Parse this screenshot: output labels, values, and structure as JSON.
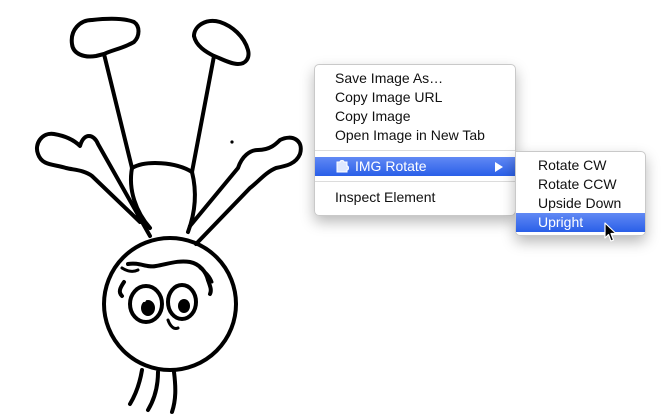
{
  "context_menu": {
    "items": [
      {
        "label": "Save Image As…"
      },
      {
        "label": "Copy Image URL"
      },
      {
        "label": "Copy Image"
      },
      {
        "label": "Open Image in New Tab"
      },
      {
        "label": "IMG Rotate"
      },
      {
        "label": "Inspect Element"
      }
    ]
  },
  "submenu": {
    "items": [
      {
        "label": "Rotate CW"
      },
      {
        "label": "Rotate CCW"
      },
      {
        "label": "Upside Down"
      },
      {
        "label": "Upright"
      }
    ]
  },
  "icons": {
    "extension_icon": "puzzle-icon",
    "arrow": "submenu-arrow-icon",
    "cursor": "mouse-pointer-icon"
  },
  "colors": {
    "selection": "#2a5fe8",
    "menu_text": "#111111"
  }
}
